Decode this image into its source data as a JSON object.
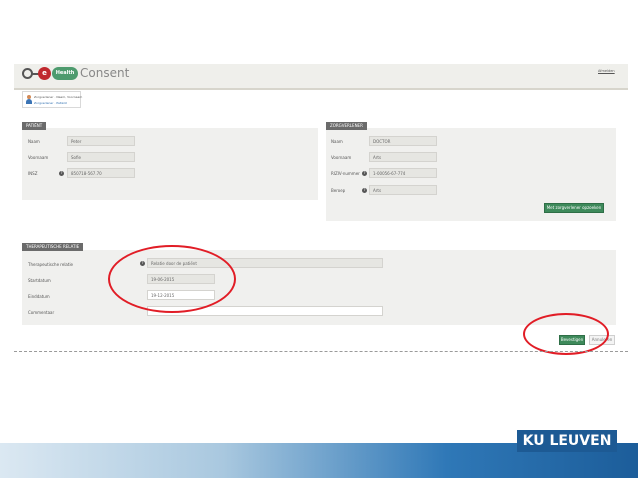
{
  "app": {
    "title": "Consent",
    "logo_e": "e",
    "logo_health": "Health",
    "logout": "Afmelden"
  },
  "tab": {
    "line1": "Zorgverlener · Naam, Voornaam",
    "line2": "Zorgverlener · Patiënt"
  },
  "patient": {
    "title": "PATIËNT",
    "fields": [
      {
        "label": "Naam",
        "value": "Peter"
      },
      {
        "label": "Voornaam",
        "value": "Sofie"
      },
      {
        "label": "INSZ",
        "value": "850718-567.70"
      }
    ]
  },
  "provider": {
    "title": "ZORGVERLENER",
    "fields": [
      {
        "label": "Naam",
        "value": "DOCTOR"
      },
      {
        "label": "Voornaam",
        "value": "Arts"
      },
      {
        "label": "RIZIV-nummer",
        "value": "1-00056-67-774"
      },
      {
        "label": "Beroep",
        "value": "Arts"
      }
    ],
    "button": "Met zorgverlener opzoeken"
  },
  "relation": {
    "title": "THERAPEUTISCHE RELATIE",
    "fields": [
      {
        "label": "Therapeutische relatie",
        "value": "Relatie door de patiënt"
      },
      {
        "label": "Startdatum",
        "value": "19-06-2015"
      },
      {
        "label": "Einddatum",
        "value": "19-12-2015"
      },
      {
        "label": "Commentaar",
        "value": ""
      }
    ]
  },
  "actions": {
    "confirm": "Bevestigen",
    "cancel": "Annuleren"
  },
  "footer": {
    "logo": "KU LEUVEN"
  },
  "colors": {
    "accent_green": "#3e8a5b",
    "annotation_red": "#e11d26",
    "brand_blue": "#1d5a94"
  }
}
